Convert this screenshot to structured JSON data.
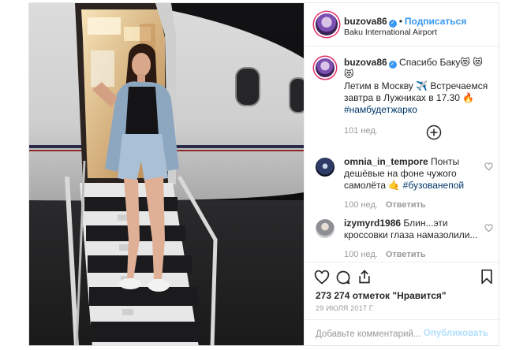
{
  "post": {
    "username": "buzova86",
    "follow_label": "Подписаться",
    "location": "Baku International Airport",
    "caption": {
      "username": "buzova86",
      "line1": "Спасибо Баку😻 😻 😻",
      "line2": "Летим в Москву ✈️  Встречаемся",
      "line3": "завтра в Лужниках в 17.30 🔥",
      "hashtag": "#намбудетжарко",
      "age": "101 нед."
    },
    "load_more_icon": "plus-circle-icon",
    "comments": [
      {
        "username": "omnia_in_tempore",
        "text_line1": "Понты",
        "text_line2": "дешёвые на фоне чужого",
        "text_line3": "самолёта 🤙",
        "hashtag": "#бузованепой",
        "age": "100 нед.",
        "reply": "Ответить"
      },
      {
        "username": "izymyrd1986",
        "text_line1": "Блин...эти",
        "text_line2": "кроссовки глаза намазолили...",
        "age": "100 нед.",
        "reply": "Ответить"
      }
    ],
    "likes": "273 274 отметок \"Нравится\"",
    "date": "29 ИЮЛЯ 2017 Г.",
    "comment_placeholder": "Добавьте комментарий...",
    "publish_label": "Опубликовать"
  },
  "colors": {
    "accent": "#3897f0",
    "hashtag": "#003569",
    "muted": "#999999",
    "border": "#efefef"
  },
  "photo_alt": "woman on airplane boarding stairs at night"
}
